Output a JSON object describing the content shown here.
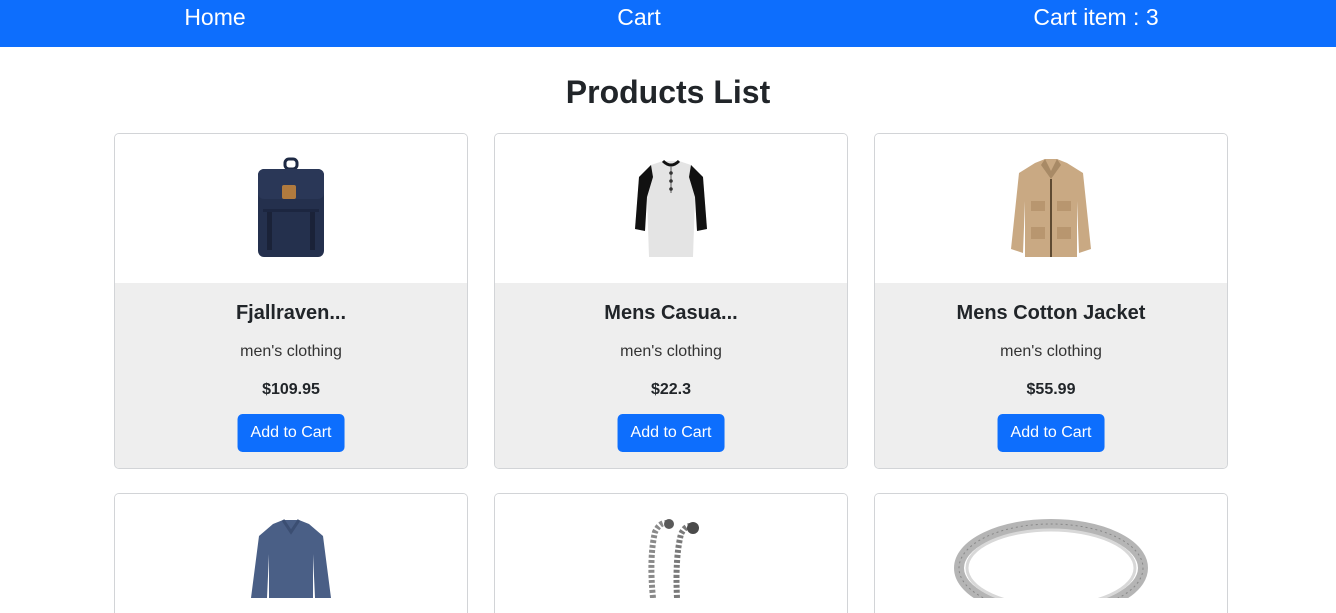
{
  "nav": {
    "home": "Home",
    "cart": "Cart",
    "cart_count": "Cart item : 3"
  },
  "page": {
    "title": "Products List"
  },
  "products": [
    {
      "title": "Fjallraven...",
      "category": "men's clothing",
      "price": "$109.95",
      "button": "Add to Cart",
      "image": "backpack-image"
    },
    {
      "title": "Mens Casua...",
      "category": "men's clothing",
      "price": "$22.3",
      "button": "Add to Cart",
      "image": "raglan-tshirt-image"
    },
    {
      "title": "Mens Cotton Jacket",
      "category": "men's clothing",
      "price": "$55.99",
      "button": "Add to Cart",
      "image": "cotton-jacket-image"
    },
    {
      "image": "blue-longsleeve-image"
    },
    {
      "image": "dragon-bracelet-image"
    },
    {
      "image": "silver-bangle-image"
    }
  ],
  "colors": {
    "primary": "#0d6efd",
    "card_body": "#eeeeee",
    "border": "#d2d4d7"
  }
}
